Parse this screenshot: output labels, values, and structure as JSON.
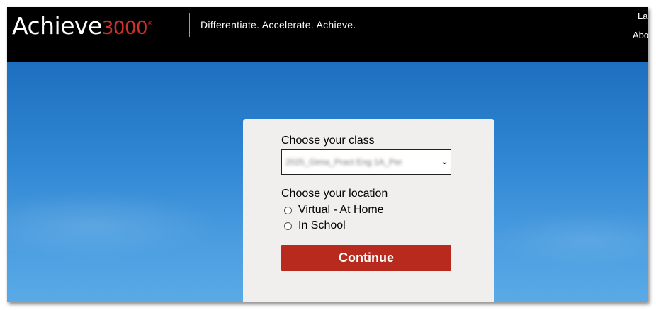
{
  "header": {
    "logo_word": "Achieve",
    "logo_number": "3000",
    "logo_mark": "®",
    "tagline": "Differentiate. Accelerate. Achieve.",
    "links": [
      "La",
      "Abo"
    ]
  },
  "form": {
    "class_label": "Choose your class",
    "class_selected": "2025_Gima_Pract Eng 1A_Per",
    "location_label": "Choose your location",
    "location_options": [
      "Virtual - At Home",
      "In School"
    ],
    "continue_label": "Continue"
  },
  "colors": {
    "header_bg": "#000000",
    "brand_red": "#d0302a",
    "button_red": "#b82a1e",
    "panel_bg": "#f0efed",
    "sky_blue": "#2f86d2"
  },
  "icons": {
    "select_arrow": "chevron-down-icon",
    "radio": "radio-unchecked-icon"
  }
}
